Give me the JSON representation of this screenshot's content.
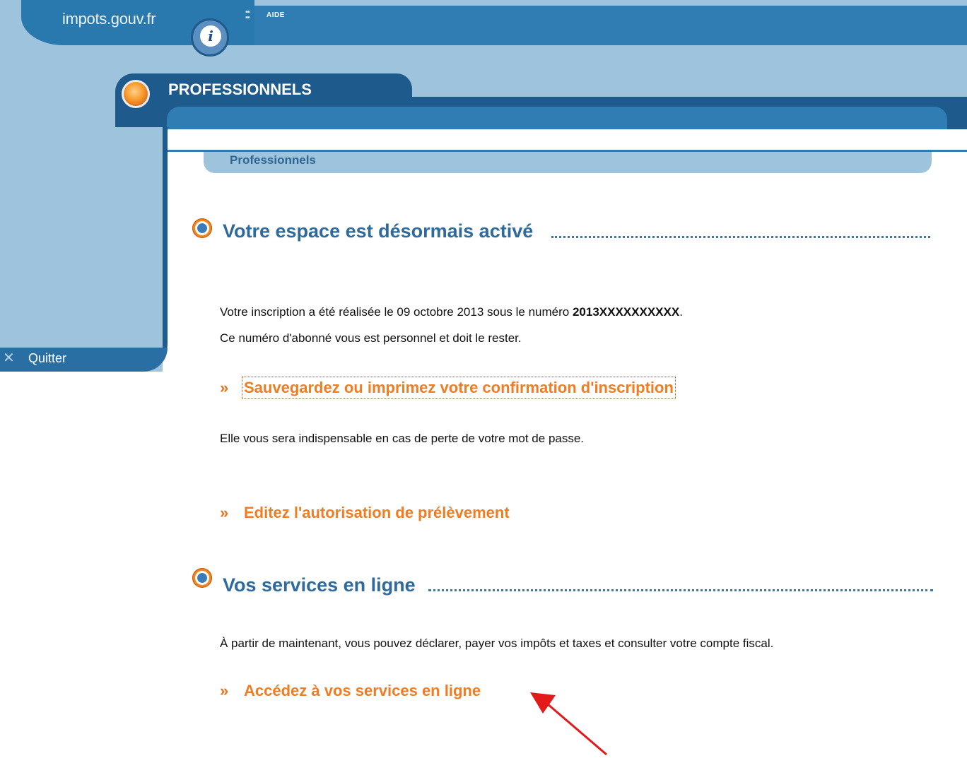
{
  "header": {
    "logo_text": "impots.gouv.fr",
    "aide_label": "AIDE",
    "section_title": "PROFESSIONNELS"
  },
  "breadcrumb": {
    "label": "Professionnels"
  },
  "sidebar": {
    "quit_label": "Quitter"
  },
  "main": {
    "section1": {
      "title": "Votre espace est désormais activé",
      "line1_prefix": "Votre inscription a été réalisée le 09 octobre 2013 sous le numéro ",
      "line1_number": "2013XXXXXXXXXX",
      "line1_suffix": ".",
      "line2": "Ce numéro d'abonné vous est personnel et doit le rester.",
      "save_link": "Sauvegardez ou imprimez votre confirmation d'inscription",
      "save_note": "Elle vous sera indispensable en cas de perte de votre mot de passe.",
      "debit_link": "Editez l'autorisation de prélèvement"
    },
    "section2": {
      "title": "Vos services en ligne",
      "text": "À partir de maintenant, vous pouvez déclarer, payer vos impôts et taxes et consulter votre compte fiscal.",
      "access_link": "Accédez à vos services en ligne"
    }
  },
  "colors": {
    "header_blue": "#2f7db3",
    "dark_blue": "#1f5a8c",
    "light_blue": "#9ec3dc",
    "link_orange": "#ee7d24",
    "annotation_red": "#e21a1a"
  },
  "icons": {
    "section_bullet": "orange-globe-icon",
    "link_bullet": "double-chevron-right-icon",
    "quit": "close-icon",
    "annotation": "red-arrow"
  }
}
